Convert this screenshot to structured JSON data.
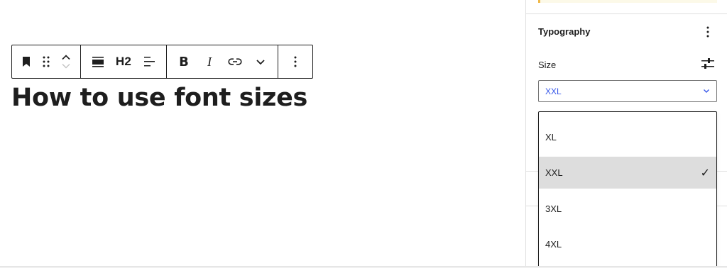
{
  "toolbar": {
    "block_type_icon": "bookmark-icon",
    "drag_icon": "drag-handle-icon",
    "move_up_icon": "chevron-up-icon",
    "move_down_icon": "chevron-down-icon",
    "align_icon": "justify-top-icon",
    "heading_level": "H2",
    "text_align_icon": "align-left-icon",
    "bold_label": "B",
    "italic_label": "I",
    "link_icon": "link-icon",
    "more_icon": "chevron-down-icon",
    "options_icon": "more-vertical-icon"
  },
  "content": {
    "heading": "How to use font sizes"
  },
  "sidebar": {
    "typography_title": "Typography",
    "size_label": "Size",
    "size_selected": "XXL",
    "options": [
      {
        "label": "XL",
        "selected": false
      },
      {
        "label": "XXL",
        "selected": true
      },
      {
        "label": "3XL",
        "selected": false
      },
      {
        "label": "4XL",
        "selected": false
      }
    ],
    "check_glyph": "✓"
  },
  "colors": {
    "text": "#1e1e1e",
    "accent": "#3858e9",
    "selected_bg": "#dddddd",
    "notice": "#f0b849"
  }
}
